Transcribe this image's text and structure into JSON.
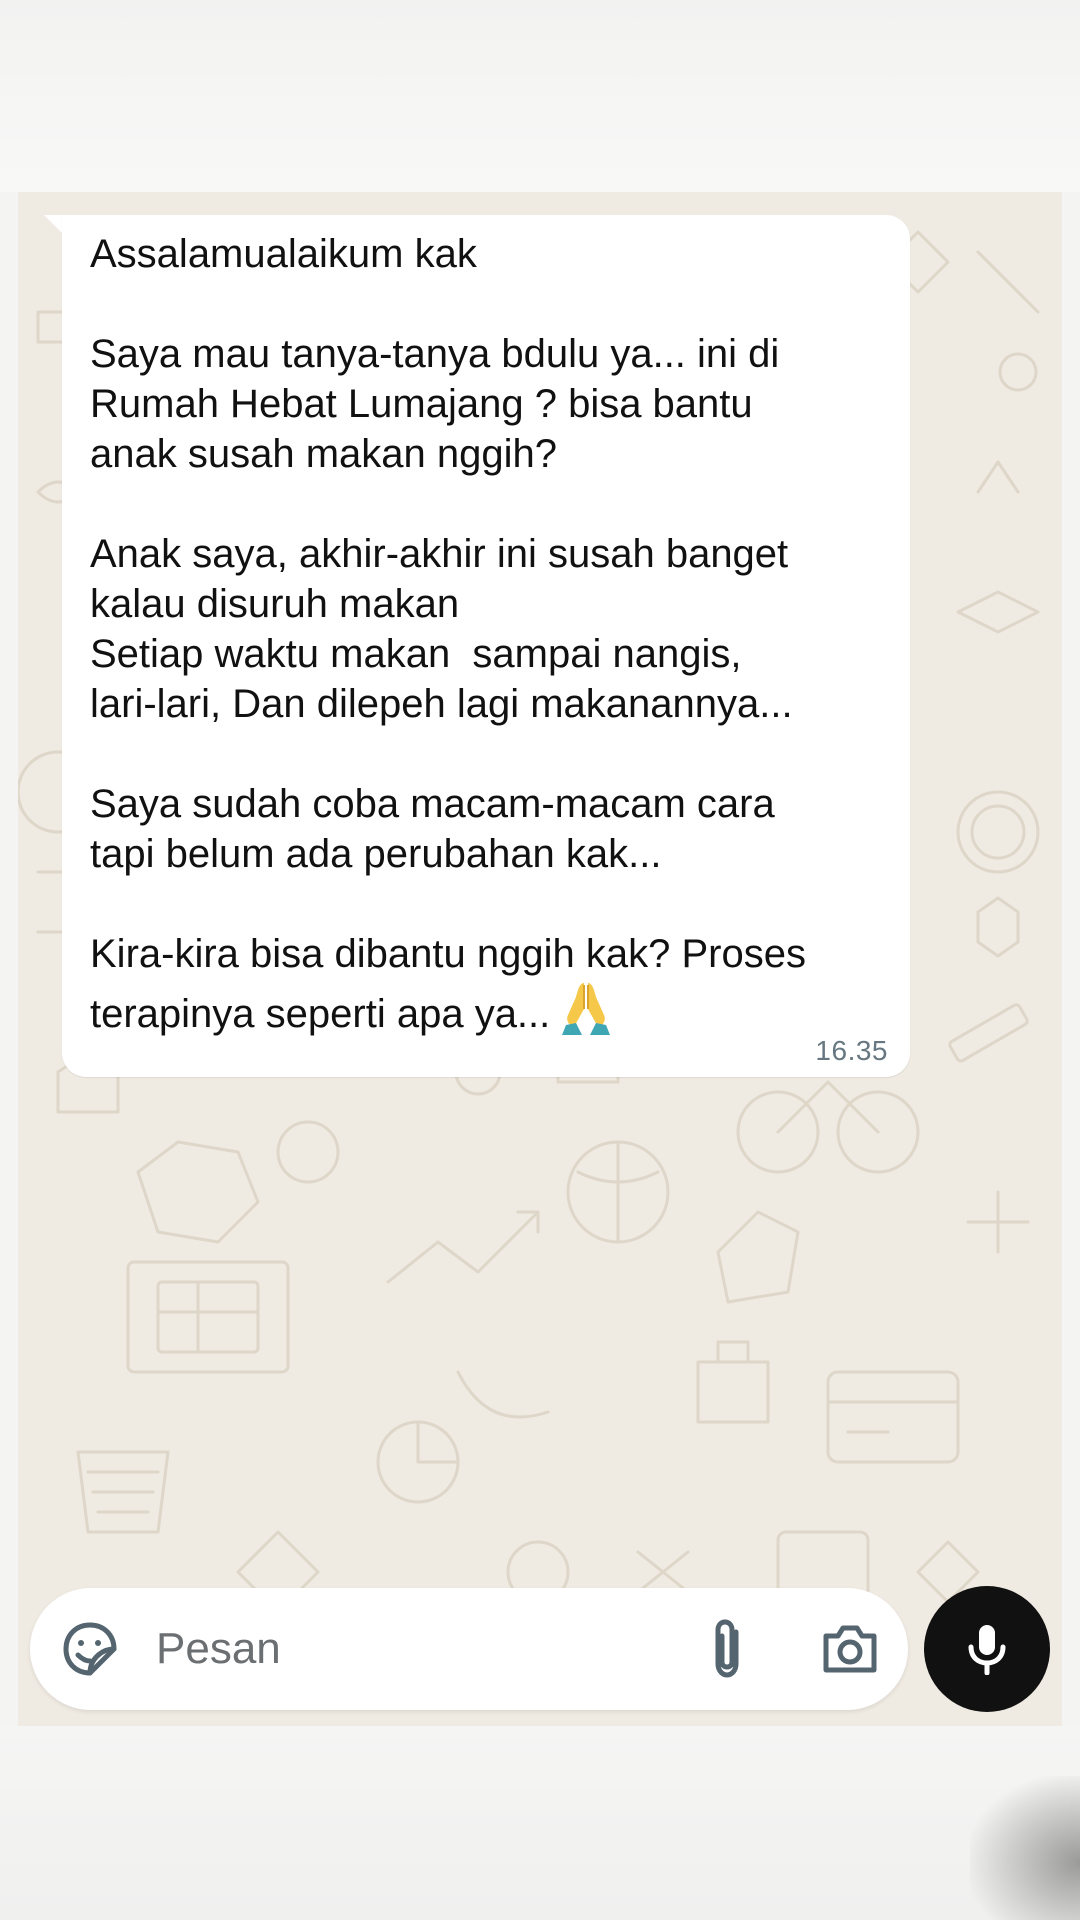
{
  "chat": {
    "message": {
      "paragraphs": [
        "Assalamualaikum kak",
        "Saya mau tanya-tanya bdulu ya... ini di\nRumah Hebat Lumajang ? bisa bantu\nanak susah makan nggih?",
        "Anak saya, akhir-akhir ini susah banget\nkalau disuruh makan\nSetiap waktu makan  sampai nangis,\nlari-lari, Dan dilepeh lagi makanannya...",
        "Saya sudah coba macam-macam cara\ntapi belum ada perubahan kak...",
        "Kira-kira bisa dibantu nggih kak? Proses\nterapinya seperti apa ya..."
      ],
      "emoji": "🙏",
      "emoji_icon": "folded-hands-icon",
      "time": "16.35"
    }
  },
  "composer": {
    "placeholder": "Pesan",
    "sticker_icon": "sticker-icon",
    "attach_icon": "paperclip-icon",
    "camera_icon": "camera-icon",
    "mic_icon": "microphone-icon"
  },
  "colors": {
    "wallpaper": "#efeae2",
    "bubble": "#ffffff",
    "mic_button": "#111111",
    "icon": "#54656f",
    "time": "#667781"
  }
}
